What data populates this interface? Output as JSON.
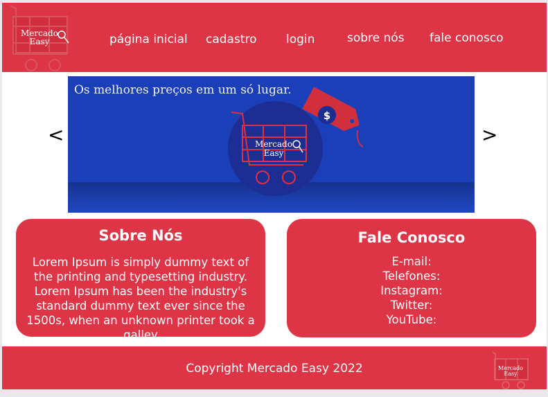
{
  "brand": {
    "logo_line1": "Mercado",
    "logo_line2": "Easy"
  },
  "nav": {
    "home": "página inicial",
    "register": "cadastro",
    "login": "login",
    "about": "sobre nós",
    "contact": "fale conosco"
  },
  "carousel": {
    "prev": "<",
    "next": ">",
    "tagline": "Os melhores preços em um só lugar.",
    "price_tag_symbol": "$"
  },
  "about": {
    "title": "Sobre Nós",
    "body": "Lorem Ipsum is simply dummy text of the printing and typesetting industry. Lorem Ipsum has been the industry's standard dummy text ever since the 1500s, when an unknown printer took a galley"
  },
  "contact": {
    "title": "Fale Conosco",
    "email": "E-mail:",
    "phones": "Telefones:",
    "instagram": "Instagram:",
    "twitter": "Twitter:",
    "youtube": "YouTube:"
  },
  "footer": {
    "copyright": "Copyright Mercado Easy 2022"
  },
  "colors": {
    "brand_red": "#dd3545",
    "banner_blue": "#1a3fb8",
    "white": "#ffffff"
  }
}
